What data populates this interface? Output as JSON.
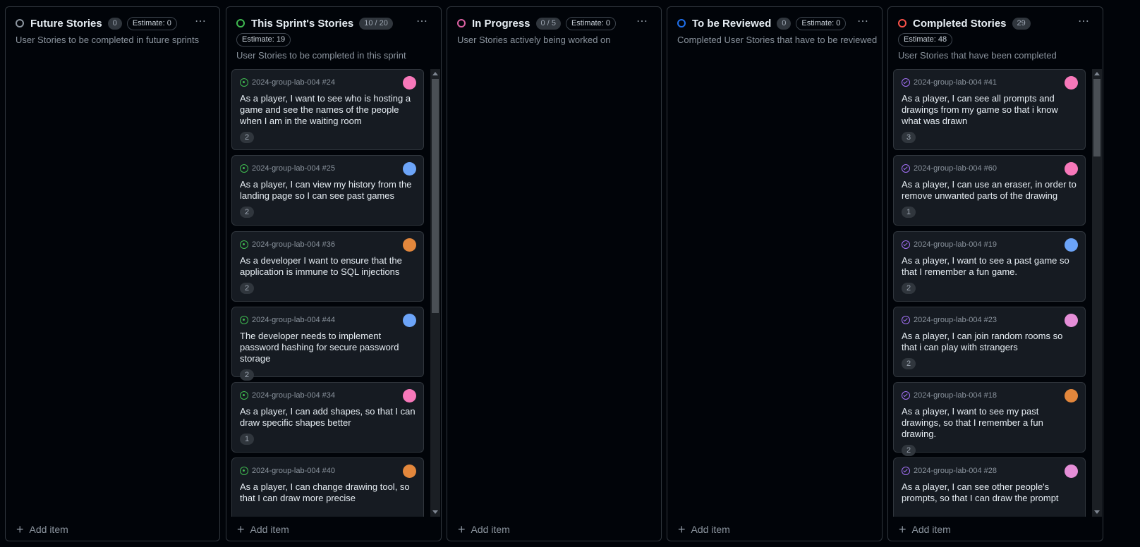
{
  "columns": [
    {
      "title": "Future Stories",
      "count": "0",
      "estimate": "Estimate: 0",
      "description": "User Stories to be completed in future sprints",
      "status_color": "#8b949e",
      "add_label": "Add item",
      "cards": []
    },
    {
      "title": "This Sprint's Stories",
      "count": "10 / 20",
      "estimate": "Estimate: 19",
      "description": "User Stories to be completed in this sprint",
      "status_color": "#3fb950",
      "add_label": "Add item",
      "cards": [
        {
          "ref": "2024-group-lab-004 #24",
          "title": "As a player, I want to see who is hosting a game and see the names of the people when I am in the waiting room",
          "points": "2",
          "avatar_color": "#f778ba",
          "state": "open"
        },
        {
          "ref": "2024-group-lab-004 #25",
          "title": "As a player, I can view my history from the landing page so I can see past games",
          "points": "2",
          "avatar_color": "#6ca4f8",
          "state": "open"
        },
        {
          "ref": "2024-group-lab-004 #36",
          "title": "As a developer I want to ensure that the application is immune to SQL injections",
          "points": "2",
          "avatar_color": "#e3873c",
          "state": "open"
        },
        {
          "ref": "2024-group-lab-004 #44",
          "title": "The developer needs to implement password hashing for secure password storage",
          "points": "2",
          "avatar_color": "#6ca4f8",
          "state": "open"
        },
        {
          "ref": "2024-group-lab-004 #34",
          "title": "As a player, I can add shapes, so that I can draw specific shapes better",
          "points": "1",
          "avatar_color": "#f778ba",
          "state": "open"
        },
        {
          "ref": "2024-group-lab-004 #40",
          "title": "As a player, I can change drawing tool, so that I can draw more precise",
          "points": "",
          "avatar_color": "#e3873c",
          "state": "open"
        }
      ]
    },
    {
      "title": "In Progress",
      "count": "0 / 5",
      "estimate": "Estimate: 0",
      "description": "User Stories actively being worked on",
      "status_color": "#db61a2",
      "add_label": "Add item",
      "cards": []
    },
    {
      "title": "To be Reviewed",
      "count": "0",
      "estimate": "Estimate: 0",
      "description": "Completed User Stories that have to be reviewed",
      "status_color": "#1f6feb",
      "add_label": "Add item",
      "cards": []
    },
    {
      "title": "Completed Stories",
      "count": "29",
      "estimate": "Estimate: 48",
      "description": "User Stories that have been completed",
      "status_color": "#f85149",
      "add_label": "Add item",
      "cards": [
        {
          "ref": "2024-group-lab-004 #41",
          "title": "As a player, I can see all prompts and drawings from my game so that i know what was drawn",
          "points": "3",
          "avatar_color": "#f778ba",
          "state": "done"
        },
        {
          "ref": "2024-group-lab-004 #60",
          "title": "As a player, I can use an eraser, in order to remove unwanted parts of the drawing",
          "points": "1",
          "avatar_color": "#f778ba",
          "state": "done"
        },
        {
          "ref": "2024-group-lab-004 #19",
          "title": "As a player, I want to see a past game so that I remember a fun game.",
          "points": "2",
          "avatar_color": "#6ca4f8",
          "state": "done"
        },
        {
          "ref": "2024-group-lab-004 #23",
          "title": "As a player, I can join random rooms so that i can play with strangers",
          "points": "2",
          "avatar_color": "#e58ed8",
          "state": "done"
        },
        {
          "ref": "2024-group-lab-004 #18",
          "title": "As a player, I want to see my past drawings, so that I remember a fun drawing.",
          "points": "2",
          "avatar_color": "#e3873c",
          "state": "done"
        },
        {
          "ref": "2024-group-lab-004 #28",
          "title": "As a player, I can see other people's prompts, so that I can draw the prompt",
          "points": "",
          "avatar_color": "#e58ed8",
          "state": "done"
        }
      ]
    }
  ]
}
